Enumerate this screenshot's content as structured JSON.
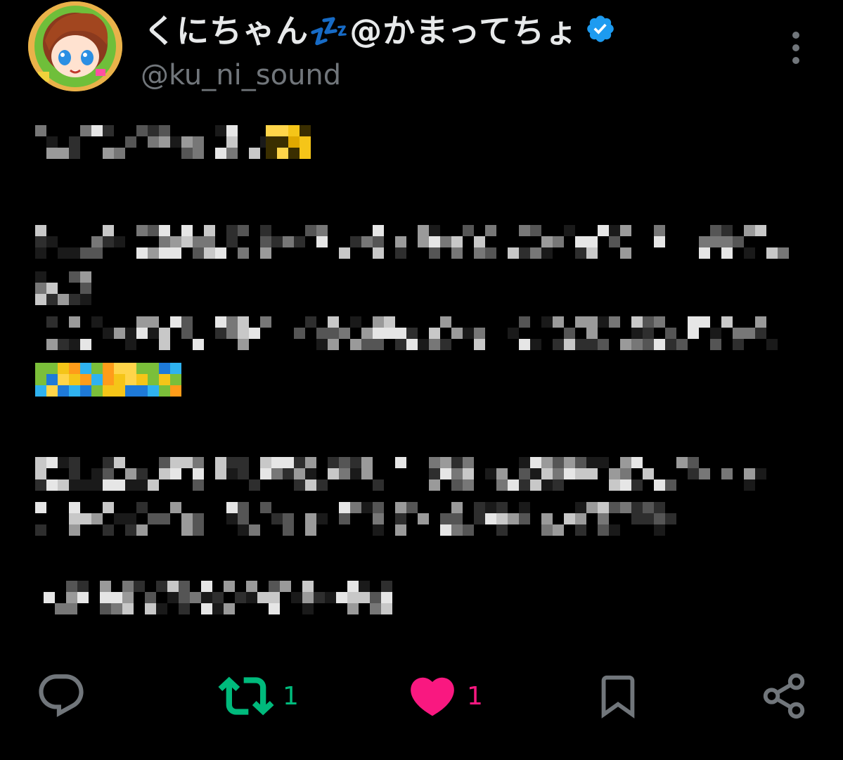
{
  "user": {
    "display_name": "くにちゃん💤@かまってちょ",
    "handle": "@ku_ni_sound",
    "verified": true
  },
  "tweet": {
    "text_censored": true
  },
  "actions": {
    "retweet_count": "1",
    "like_count": "1",
    "liked": true
  },
  "colors": {
    "background": "#000000",
    "verified_badge": "#1d9bf0",
    "retweet_green": "#00ba7c",
    "like_pink": "#f91880",
    "muted_gray": "#71767b"
  }
}
